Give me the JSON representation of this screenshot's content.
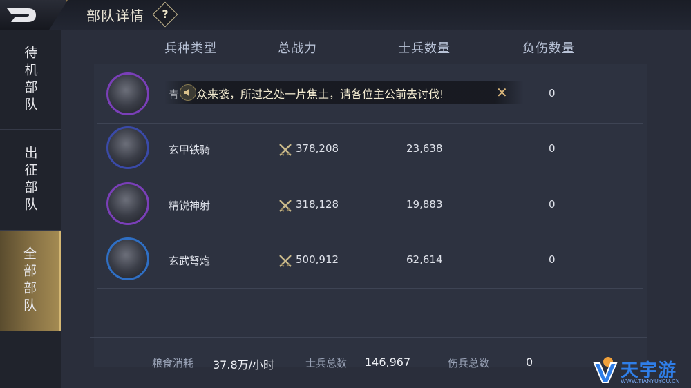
{
  "header": {
    "title": "部队详情",
    "help_glyph": "?"
  },
  "sidebar": {
    "tabs": [
      {
        "label": "待机部队",
        "active": false
      },
      {
        "label": "出征部队",
        "active": false
      },
      {
        "label": "全部部队",
        "active": true
      }
    ]
  },
  "table": {
    "columns": [
      "兵种类型",
      "总战力",
      "士兵数量",
      "负伤数量"
    ],
    "rows": [
      {
        "name": "青",
        "power": "",
        "soldiers": "",
        "wounded": "0",
        "ring_color": "#7a3fb8"
      },
      {
        "name": "玄甲铁骑",
        "power": "378,208",
        "soldiers": "23,638",
        "wounded": "0",
        "ring_color": "#3a4aa8"
      },
      {
        "name": "精锐神射",
        "power": "318,128",
        "soldiers": "19,883",
        "wounded": "0",
        "ring_color": "#7a3fb8"
      },
      {
        "name": "玄武弩炮",
        "power": "500,912",
        "soldiers": "62,614",
        "wounded": "0",
        "ring_color": "#2f6fc4"
      }
    ]
  },
  "banner": {
    "text": "众来袭，所过之处一片焦土，请各位主公前去讨伐!",
    "close_glyph": "✕"
  },
  "footer": {
    "food_label": "粮食消耗",
    "food_value": "37.8万/小时",
    "soldiers_label": "士兵总数",
    "soldiers_value": "146,967",
    "wounded_label": "伤兵总数",
    "wounded_value": "0"
  },
  "watermark": {
    "text": "天宇游",
    "sub": "WWW.TIANYUYOU.CN"
  },
  "colors": {
    "accent_gold": "#d4b773",
    "watermark_blue": "#2f7ee8"
  },
  "icons": [
    "back-icon",
    "help-icon",
    "sword-icon",
    "speaker-icon",
    "close-icon"
  ]
}
